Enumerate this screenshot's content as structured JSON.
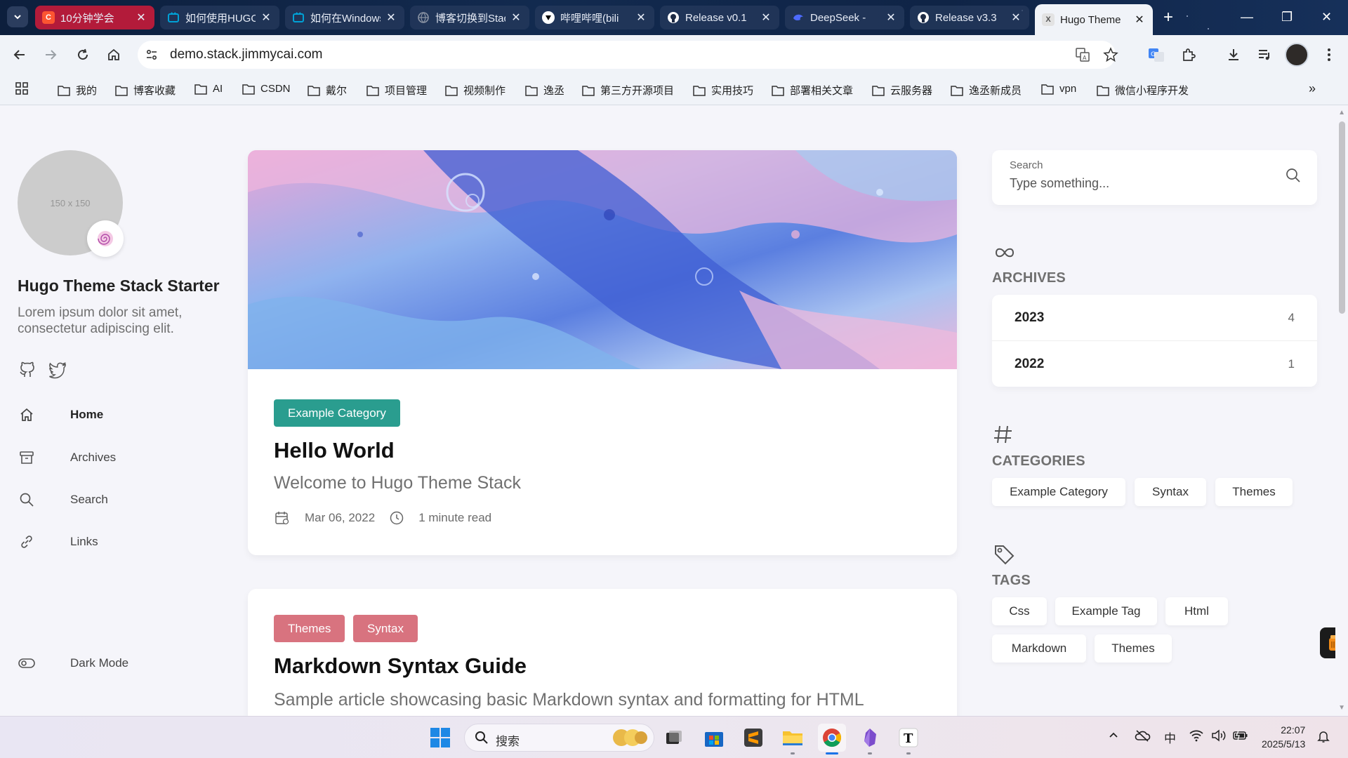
{
  "browser": {
    "tabs": [
      {
        "title": "10分钟学会",
        "favicon": "csdn-icon",
        "color": "#fc5531"
      },
      {
        "title": "如何使用HUGO",
        "favicon": "bilibili-icon",
        "color": "#00a1d6"
      },
      {
        "title": "如何在Windows",
        "favicon": "bilibili-icon",
        "color": "#00a1d6"
      },
      {
        "title": "博客切换到Stack",
        "favicon": "web-icon",
        "color": "#5f6368"
      },
      {
        "title": "哔哩哔哩(bili",
        "favicon": "tiktok-icon",
        "color": "#000000"
      },
      {
        "title": "Release v0.1",
        "favicon": "github-icon",
        "color": "#ffffff"
      },
      {
        "title": "DeepSeek -",
        "favicon": "deepseek-icon",
        "color": "#4d6bfe"
      },
      {
        "title": "Release v3.3",
        "favicon": "github-icon",
        "color": "#ffffff"
      },
      {
        "title": "Hugo Theme",
        "favicon": "stack-icon",
        "color": "#e3e3e3"
      }
    ],
    "new_tab_label": "+",
    "url": "demo.stack.jimmycai.com",
    "bookmarks": [
      "我的",
      "博客收藏",
      "AI",
      "CSDN",
      "戴尔",
      "项目管理",
      "视频制作",
      "逸丞",
      "第三方开源项目",
      "实用技巧",
      "部署相关文章",
      "云服务器",
      "逸丞新成员",
      "vpn",
      "微信小程序开发"
    ]
  },
  "sidebar": {
    "avatar_text": "150 x 150",
    "site_title": "Hugo Theme Stack Starter",
    "site_description": "Lorem ipsum dolor sit amet, consectetur adipiscing elit.",
    "menu": [
      {
        "label": "Home",
        "icon": "home-icon",
        "current": true
      },
      {
        "label": "Archives",
        "icon": "archive-box-icon",
        "current": false
      },
      {
        "label": "Search",
        "icon": "search-icon",
        "current": false
      },
      {
        "label": "Links",
        "icon": "link-icon",
        "current": false
      }
    ],
    "dark_mode_label": "Dark Mode"
  },
  "posts": [
    {
      "categories": [
        {
          "label": "Example Category",
          "color": "#2a9d8f"
        }
      ],
      "title": "Hello World",
      "subtitle": "Welcome to Hugo Theme Stack",
      "date": "Mar 06, 2022",
      "read_time": "1 minute read"
    },
    {
      "categories": [
        {
          "label": "Themes",
          "color": "#d8737f"
        },
        {
          "label": "Syntax",
          "color": "#d8737f"
        }
      ],
      "title": "Markdown Syntax Guide",
      "subtitle": "Sample article showcasing basic Markdown syntax and formatting for HTML"
    }
  ],
  "widgets": {
    "search": {
      "label": "Search",
      "placeholder": "Type something..."
    },
    "archives": {
      "title": "ARCHIVES",
      "items": [
        {
          "year": "2023",
          "count": "4"
        },
        {
          "year": "2022",
          "count": "1"
        }
      ]
    },
    "categories": {
      "title": "CATEGORIES",
      "items": [
        "Example Category",
        "Syntax",
        "Themes"
      ]
    },
    "tags": {
      "title": "TAGS",
      "items": [
        "Css",
        "Example Tag",
        "Html",
        "Markdown",
        "Themes"
      ]
    }
  },
  "taskbar": {
    "search_placeholder": "搜索",
    "ime": "中",
    "time": "22:07",
    "date": "2025/5/13"
  }
}
